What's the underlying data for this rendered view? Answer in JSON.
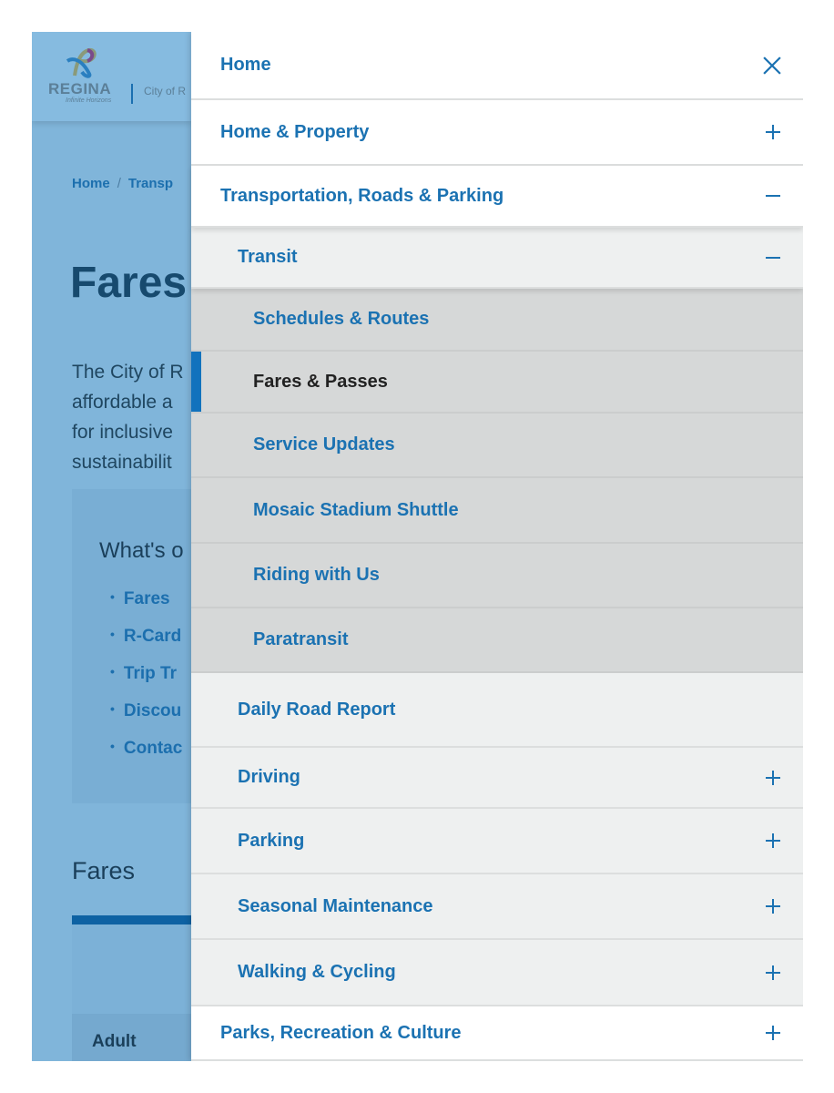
{
  "background_page": {
    "logo": {
      "wordmark": "REGINA",
      "tagline": "Infinite Horizons"
    },
    "site_name": "City of R",
    "breadcrumb": [
      "Home",
      "Transp"
    ],
    "title": "Fares",
    "intro_lines": [
      "The City of R",
      "affordable a",
      "for inclusive",
      "sustainabilit"
    ],
    "on_this_page": {
      "heading": "What's o",
      "links": [
        "Fares",
        "R-Card",
        "Trip Tr",
        "Discou",
        "Contac"
      ]
    },
    "section_heading": "Fares",
    "table_first_row": "Adult"
  },
  "menu": {
    "close_icon": "close-icon",
    "items": [
      {
        "label": "Home",
        "level": 1,
        "icon": "close"
      },
      {
        "label": "Home & Property",
        "level": 1,
        "icon": "plus"
      },
      {
        "label": "Transportation, Roads & Parking",
        "level": 1,
        "icon": "minus"
      },
      {
        "label": "Transit",
        "level": 2,
        "icon": "minus"
      },
      {
        "label": "Schedules & Routes",
        "level": 3
      },
      {
        "label": "Fares & Passes",
        "level": 3,
        "active": true
      },
      {
        "label": "Service Updates",
        "level": 3
      },
      {
        "label": "Mosaic Stadium Shuttle",
        "level": 3
      },
      {
        "label": "Riding with Us",
        "level": 3
      },
      {
        "label": "Paratransit",
        "level": 3
      },
      {
        "label": "Daily Road Report",
        "level": 2
      },
      {
        "label": "Driving",
        "level": 2,
        "icon": "plus"
      },
      {
        "label": "Parking",
        "level": 2,
        "icon": "plus"
      },
      {
        "label": "Seasonal Maintenance",
        "level": 2,
        "icon": "plus"
      },
      {
        "label": "Walking & Cycling",
        "level": 2,
        "icon": "plus"
      },
      {
        "label": "Parks, Recreation & Culture",
        "level": 1,
        "icon": "plus"
      }
    ]
  },
  "colors": {
    "link": "#1b72b2",
    "active_bar": "#1172bd",
    "overlay": "#80b5da",
    "level3_bg": "#d6d8d8",
    "level2_bg": "#eef0f0"
  }
}
